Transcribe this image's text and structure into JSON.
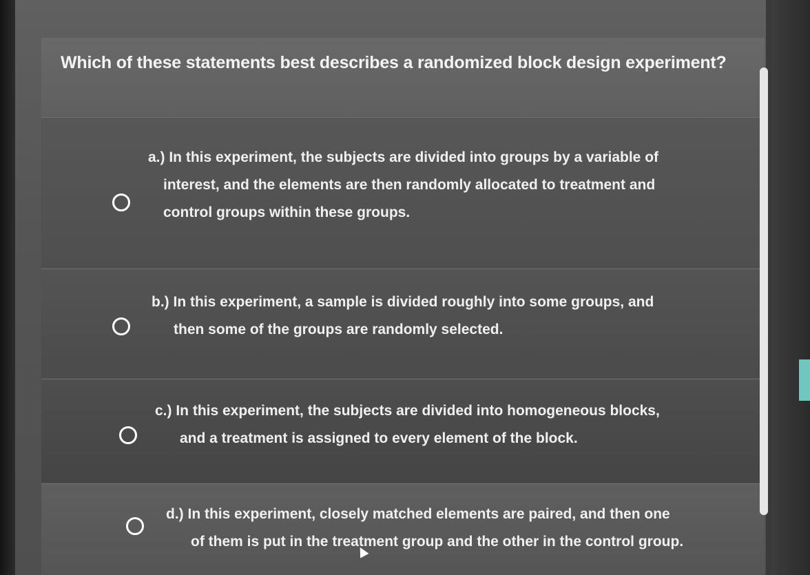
{
  "question": {
    "text": "Which of these statements best describes a randomized block design experiment?"
  },
  "options": [
    {
      "lines": [
        "a.) In this experiment, the subjects are divided into groups by a variable of",
        "interest, and the elements are then randomly allocated to treatment and",
        "control groups within these groups."
      ],
      "selected": false
    },
    {
      "lines": [
        "b.) In this experiment, a sample is divided roughly into some groups, and",
        "then some of the groups are randomly selected."
      ],
      "selected": false
    },
    {
      "lines": [
        "c.) In this experiment, the subjects are divided into homogeneous blocks,",
        "and a treatment is assigned to every element of the block."
      ],
      "selected": false
    },
    {
      "lines": [
        "d.) In this experiment, closely matched elements are paired, and then one",
        "of them is put in the treatment group and the other in the control group."
      ],
      "selected": false
    }
  ],
  "colors": {
    "text": "#f0f0f0",
    "radio": "#ffffff",
    "accent_tab": "#6fc7c0"
  }
}
